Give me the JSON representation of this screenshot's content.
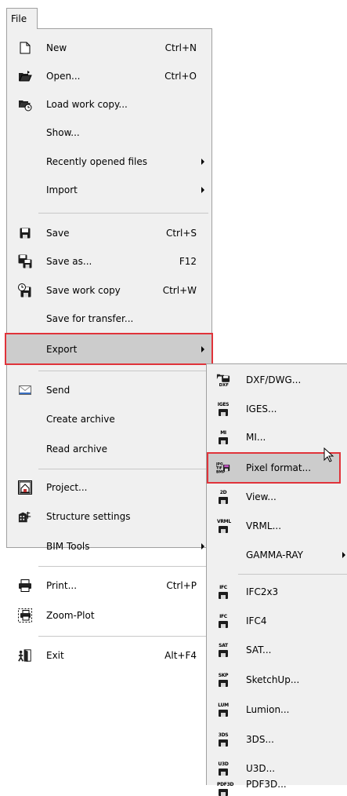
{
  "file_tab": "File",
  "file_menu": {
    "items": [
      {
        "label": "New",
        "shortcut": "Ctrl+N",
        "icon": "new-document-icon"
      },
      {
        "label": "Open...",
        "shortcut": "Ctrl+O",
        "icon": "open-folder-icon"
      },
      {
        "label": "Load work copy...",
        "shortcut": "",
        "icon": "load-work-copy-icon"
      },
      {
        "label": "Show...",
        "shortcut": ""
      },
      {
        "label": "Recently opened files",
        "shortcut": "",
        "submenu": true
      },
      {
        "label": "Import",
        "shortcut": "",
        "submenu": true
      },
      {
        "label": "Save",
        "shortcut": "Ctrl+S",
        "icon": "save-disk-icon"
      },
      {
        "label": "Save as...",
        "shortcut": "F12",
        "icon": "save-as-icon"
      },
      {
        "label": "Save work copy",
        "shortcut": "Ctrl+W",
        "icon": "save-work-copy-icon"
      },
      {
        "label": "Save for transfer...",
        "shortcut": ""
      },
      {
        "label": "Export",
        "shortcut": "",
        "submenu": true,
        "highlighted": true
      },
      {
        "label": "Send",
        "shortcut": "",
        "icon": "send-envelope-icon"
      },
      {
        "label": "Create archive",
        "shortcut": ""
      },
      {
        "label": "Read archive",
        "shortcut": ""
      },
      {
        "label": "Project...",
        "shortcut": "",
        "icon": "project-icon"
      },
      {
        "label": "Structure settings",
        "shortcut": "",
        "icon": "structure-settings-icon"
      },
      {
        "label": "BIM Tools",
        "shortcut": "",
        "submenu": true
      },
      {
        "label": "Print...",
        "shortcut": "Ctrl+P",
        "icon": "printer-icon"
      },
      {
        "label": "Zoom-Plot",
        "shortcut": "",
        "icon": "zoom-plot-icon"
      },
      {
        "label": "Exit",
        "shortcut": "Alt+F4",
        "icon": "exit-door-icon"
      }
    ]
  },
  "export_submenu": {
    "items": [
      {
        "label": "DXF/DWG...",
        "tag": "DXF",
        "icon": "dxf-dwg-icon"
      },
      {
        "label": "IGES...",
        "tag": "IGES",
        "icon": "iges-icon"
      },
      {
        "label": "MI...",
        "tag": "MI",
        "icon": "mi-icon"
      },
      {
        "label": "Pixel format...",
        "tag": "JPG TIF BMP",
        "icon": "pixel-format-icon",
        "highlighted": true
      },
      {
        "label": "View...",
        "tag": "2D",
        "icon": "view-icon"
      },
      {
        "label": "VRML...",
        "tag": "VRML",
        "icon": "vrml-icon"
      },
      {
        "label": "GAMMA-RAY",
        "submenu": true
      },
      {
        "label": "IFC2x3",
        "tag": "IFC",
        "icon": "ifc2x3-icon"
      },
      {
        "label": "IFC4",
        "tag": "IFC",
        "icon": "ifc4-icon"
      },
      {
        "label": "SAT...",
        "tag": "SAT",
        "icon": "sat-icon"
      },
      {
        "label": "SketchUp...",
        "tag": "SKP",
        "icon": "sketchup-icon"
      },
      {
        "label": "Lumion...",
        "tag": "LUM",
        "icon": "lumion-icon"
      },
      {
        "label": "3DS...",
        "tag": "3DS",
        "icon": "3ds-icon"
      },
      {
        "label": "U3D...",
        "tag": "U3D",
        "icon": "u3d-icon"
      },
      {
        "label": "PDF3D...",
        "tag": "PDF3D",
        "icon": "pdf3d-icon"
      }
    ]
  },
  "colors": {
    "menu_bg": "#f0f0f0",
    "highlight_bg": "#cccccc",
    "highlight_border": "#e0333a",
    "separator": "#c8c8c8"
  }
}
